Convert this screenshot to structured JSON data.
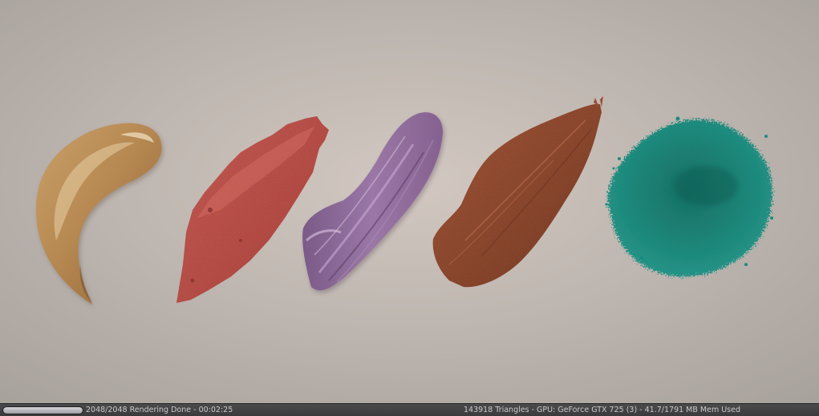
{
  "viewport": {
    "background_center": "#d2c8c1",
    "background_edge": "#a7a19c",
    "swatches": [
      {
        "name": "foundation-swatch",
        "color": "#b88b5a"
      },
      {
        "name": "lipstick-swatch",
        "color": "#c9564f"
      },
      {
        "name": "purple-cream-swatch",
        "color": "#8b6796"
      },
      {
        "name": "bronze-cream-swatch",
        "color": "#9a4e33"
      },
      {
        "name": "teal-powder-swatch",
        "color": "#1e8a7d"
      }
    ]
  },
  "statusbar": {
    "progress": 1.0,
    "render_status": "2048/2048 Rendering Done - 00:02:25",
    "scene_stats": "143918 Triangles - GPU: GeForce GTX 725 (3) - 41.7/1791 MB Mem Used"
  }
}
